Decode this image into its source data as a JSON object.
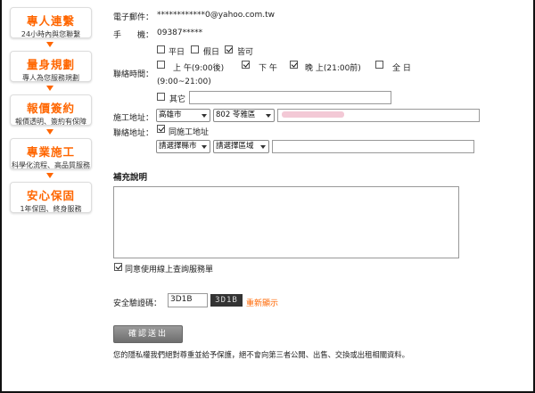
{
  "sidebar": {
    "steps": [
      {
        "title": "專人連繫",
        "sub": "24小時內與您聯繫"
      },
      {
        "title": "量身規劃",
        "sub": "專人為您服務規劃"
      },
      {
        "title": "報價簽約",
        "sub": "報價透明、簽約有保障"
      },
      {
        "title": "專業施工",
        "sub": "科學化流程、高品質服務"
      },
      {
        "title": "安心保固",
        "sub": "1年保固、終身服務"
      }
    ],
    "accent": "#ff6600"
  },
  "form": {
    "email_label": "電子郵件：",
    "email_value": "************0@yahoo.com.tw",
    "mobile_label": "手　　機：",
    "mobile_value": "09387*****",
    "contact_time_label": "聯絡時間：",
    "days": [
      {
        "label": "平日",
        "checked": false
      },
      {
        "label": "假日",
        "checked": false
      },
      {
        "label": "皆可",
        "checked": true
      }
    ],
    "times": [
      {
        "label": "上 午(9:00後)",
        "checked": false
      },
      {
        "label": "下 午",
        "checked": true
      },
      {
        "label": "晚 上(21:00前)",
        "checked": true
      },
      {
        "label": "全 日",
        "checked": false
      }
    ],
    "full_day_range": "(9:00~21:00)",
    "other_label": "其它",
    "other_checked": false,
    "other_value": "",
    "site_address_label": "施工地址：",
    "site_city": "高雄市",
    "site_district": "802 苓雅區",
    "site_address_value": "",
    "contact_address_label": "聯絡地址：",
    "same_as_site_label": "同施工地址",
    "same_as_site_checked": true,
    "contact_city_placeholder": "請選擇縣市",
    "contact_district_placeholder": "請選擇區域",
    "contact_address_value": "",
    "notes_title": "補充說明",
    "notes_value": "",
    "agree_label": "同意使用線上查詢服務單",
    "agree_checked": true,
    "captcha_label": "安全驗證碼：",
    "captcha_value": "3D1B",
    "captcha_image_text": "3D1B",
    "refresh_label": "重新顯示",
    "submit_label": "確認送出",
    "privacy_note": "您的隱私權我們絕對尊重並給予保護，絕不會向第三者公開、出售、交換或出租相關資料。"
  }
}
